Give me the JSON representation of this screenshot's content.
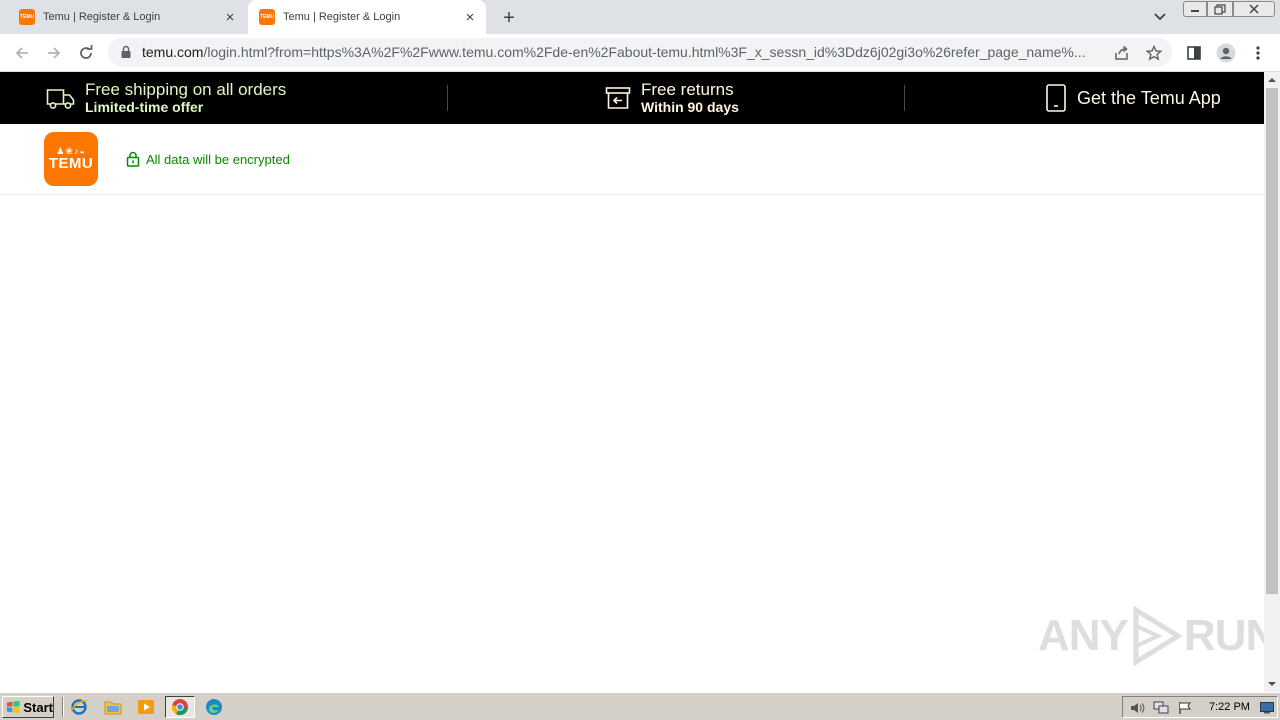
{
  "browser": {
    "tabs": [
      {
        "title": "Temu | Register & Login",
        "active": false
      },
      {
        "title": "Temu | Register & Login",
        "active": true
      }
    ],
    "favicon_text": "TEMU",
    "address": {
      "host": "temu.com",
      "path": "/login.html?from=https%3A%2F%2Fwww.temu.com%2Fde-en%2Fabout-temu.html%3F_x_sessn_id%3Ddz6j02gi3o%26refer_page_name%..."
    }
  },
  "promo_bar": {
    "shipping": {
      "title": "Free shipping on all orders",
      "subtitle": "Limited-time offer"
    },
    "returns": {
      "title": "Free returns",
      "subtitle": "Within 90 days"
    },
    "app": {
      "label": "Get the Temu App"
    }
  },
  "header": {
    "logo_glyphs": "♟❀♪◒",
    "logo_text": "TEMU",
    "secure_text": "All data will be encrypted"
  },
  "watermark": {
    "text_left": "ANY",
    "text_right": "RUN"
  },
  "taskbar": {
    "start_label": "Start",
    "clock": "7:22 PM"
  },
  "colors": {
    "brand_orange": "#fb7701",
    "secure_green": "#0a8800",
    "promo_bg": "#000000"
  },
  "icons": [
    "truck-icon",
    "return-box-icon",
    "phone-icon",
    "lock-icon",
    "back-icon",
    "forward-icon",
    "reload-icon",
    "share-icon",
    "star-icon",
    "sidepanel-icon",
    "profile-icon",
    "menu-icon"
  ]
}
